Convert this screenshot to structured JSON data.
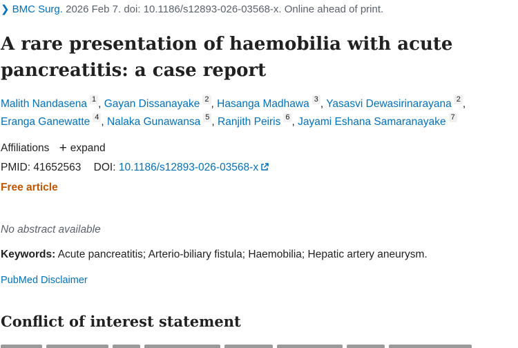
{
  "citation": {
    "journal": "BMC Surg.",
    "details": "2026 Feb 7. doi: 10.1186/s12893-026-03568-x. Online ahead of print."
  },
  "title": "A rare presentation of haemobilia with acute pancreatitis: a case report",
  "authors": [
    {
      "name": "Malith Nandasena",
      "aff": "1"
    },
    {
      "name": "Gayan Dissanayake",
      "aff": "2"
    },
    {
      "name": "Hasanga Madhawa",
      "aff": "3"
    },
    {
      "name": "Yasasvi Dewasirinarayana",
      "aff": "2"
    },
    {
      "name": "Eranga Ganewatte",
      "aff": "4"
    },
    {
      "name": "Nalaka Gunawansa",
      "aff": "5"
    },
    {
      "name": "Ranjith Peiris",
      "aff": "6"
    },
    {
      "name": "Jayami Eshana Samaranayake",
      "aff": "7"
    }
  ],
  "affiliations": {
    "label": "Affiliations",
    "expand_label": "expand"
  },
  "ids": {
    "pmid_label": "PMID:",
    "pmid": "41652563",
    "doi_label": "DOI:",
    "doi": "10.1186/s12893-026-03568-x"
  },
  "free_article": "Free article",
  "no_abstract": "No abstract available",
  "keywords": {
    "label": "Keywords:",
    "text": "Acute pancreatitis; Arterio-biliary fistula; Haemobilia; Hepatic artery aneurysm."
  },
  "disclaimer": "PubMed Disclaimer",
  "conflict_heading": "Conflict of interest statement",
  "icons": {
    "citation": "chevron-right-icon",
    "expand": "plus-icon",
    "doi_link": "external-link-icon"
  }
}
